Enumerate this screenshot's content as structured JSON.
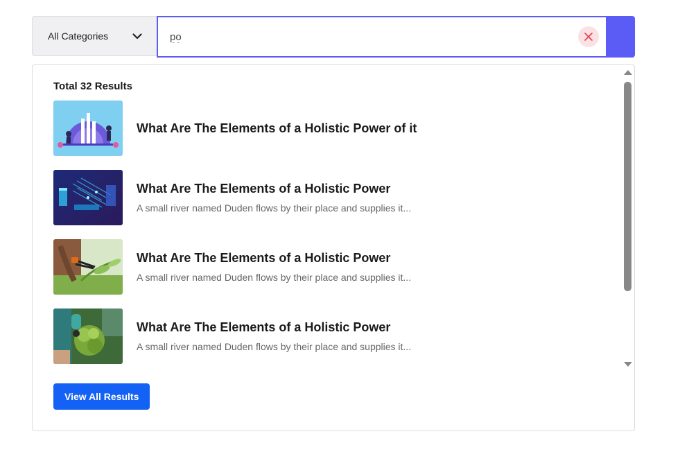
{
  "search": {
    "category_label": "All Categories",
    "query": "po",
    "colors": {
      "accent": "#5b5bf6",
      "clear_bg": "#fbe1e3",
      "clear_icon": "#e0444f"
    }
  },
  "results": {
    "total_label": "Total 32 Results",
    "items": [
      {
        "title": "What Are The Elements of a Holistic Power of it",
        "desc": "",
        "thumb_icon": "illustration-thumbnail"
      },
      {
        "title": "What Are The Elements of a Holistic Power",
        "desc": "A small river named Duden flows by their place and supplies it...",
        "thumb_icon": "server-tech-thumbnail"
      },
      {
        "title": "What Are The Elements of a Holistic Power",
        "desc": "A small river named Duden flows by their place and supplies it...",
        "thumb_icon": "pruning-plant-thumbnail"
      },
      {
        "title": "What Are The Elements of a Holistic Power",
        "desc": "A small river named Duden flows by their place and supplies it...",
        "thumb_icon": "herbs-harvest-thumbnail"
      }
    ],
    "view_all_label": "View All Results",
    "colors": {
      "button": "#1361f5"
    }
  }
}
